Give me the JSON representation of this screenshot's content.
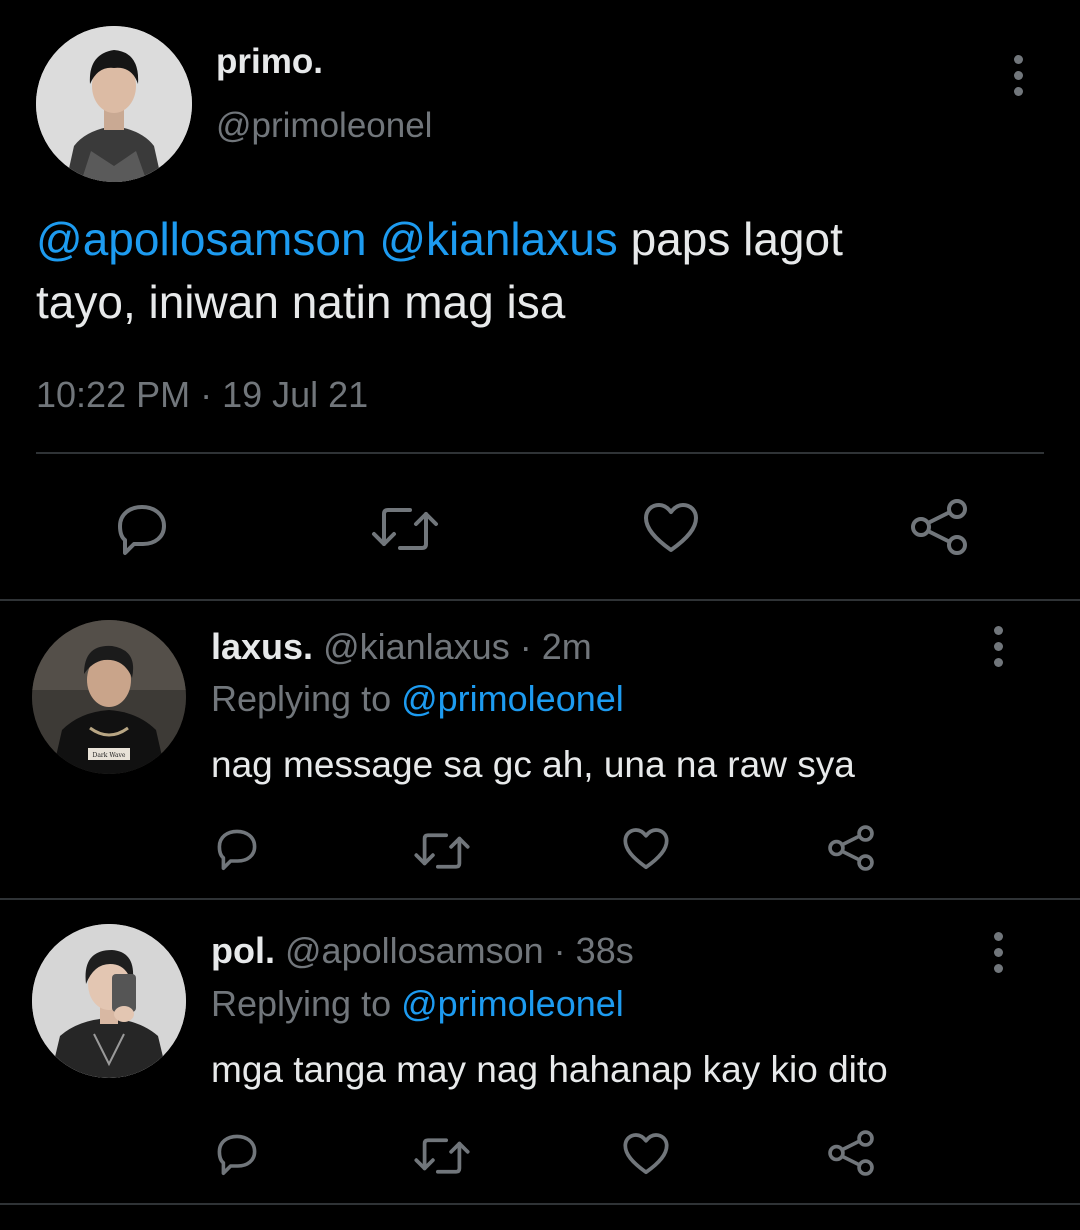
{
  "main_tweet": {
    "display_name": "primo.",
    "handle": "@primoleonel",
    "mention_1": "@apollosamson",
    "mention_2": "@kianlaxus",
    "text_part_1": " paps lagot",
    "text_part_2": "tayo, iniwan natin mag isa",
    "timestamp": "10:22 PM · 19 Jul 21",
    "avatar_icon": "user-avatar-photo",
    "more_icon": "more-vertical-icon"
  },
  "action_icons": [
    "reply-icon",
    "retweet-icon",
    "like-icon",
    "share-icon"
  ],
  "replies": [
    {
      "display_name": "laxus.",
      "handle_time": "@kianlaxus · 2m",
      "replying_prefix": "Replying to ",
      "replying_handle": "@primoleonel",
      "text": "nag message sa gc ah, una na raw sya",
      "avatar_caption": "Dark Wave"
    },
    {
      "display_name": "pol.",
      "handle_time": "@apollosamson · 38s",
      "replying_prefix": "Replying to ",
      "replying_handle": "@primoleonel",
      "text": "mga tanga may nag hahanap kay kio dito"
    }
  ],
  "colors": {
    "background": "#000000",
    "text": "#e7e9ea",
    "muted": "#71767b",
    "link": "#1d9bf0",
    "divider": "#2f3336"
  }
}
